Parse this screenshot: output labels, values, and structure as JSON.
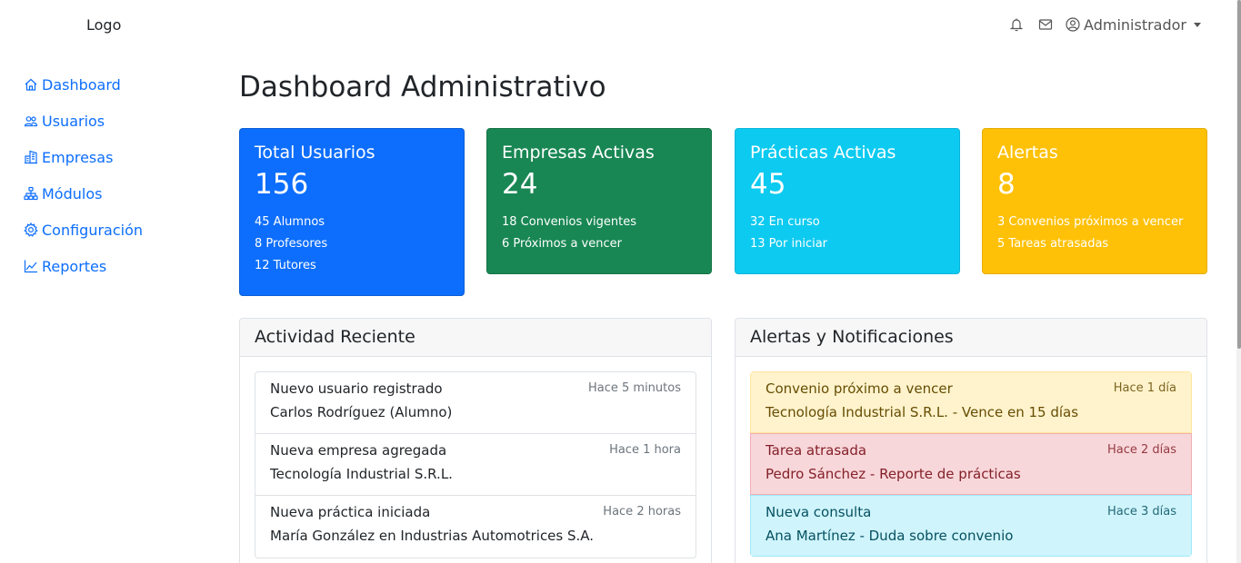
{
  "brand": {
    "logo": "Logo"
  },
  "sidebar": {
    "items": [
      {
        "label": "Dashboard",
        "icon": "house-icon"
      },
      {
        "label": "Usuarios",
        "icon": "people-icon"
      },
      {
        "label": "Empresas",
        "icon": "building-icon"
      },
      {
        "label": "Módulos",
        "icon": "diagram-icon"
      },
      {
        "label": "Configuración",
        "icon": "gear-icon"
      },
      {
        "label": "Reportes",
        "icon": "chart-line-icon"
      }
    ]
  },
  "topbar": {
    "user_label": "Administrador"
  },
  "page": {
    "title": "Dashboard Administrativo"
  },
  "stats": [
    {
      "title": "Total Usuarios",
      "value": "156",
      "lines": [
        "45 Alumnos",
        "8 Profesores",
        "12 Tutores"
      ],
      "color": "#0d6efd"
    },
    {
      "title": "Empresas Activas",
      "value": "24",
      "lines": [
        "18 Convenios vigentes",
        "6 Próximos a vencer"
      ],
      "color": "#198754"
    },
    {
      "title": "Prácticas Activas",
      "value": "45",
      "lines": [
        "32 En curso",
        "13 Por iniciar"
      ],
      "color": "#0dcaf0"
    },
    {
      "title": "Alertas",
      "value": "8",
      "lines": [
        "3 Convenios próximos a vencer",
        "5 Tareas atrasadas"
      ],
      "color": "#ffc107"
    }
  ],
  "activity": {
    "title": "Actividad Reciente",
    "items": [
      {
        "title": "Nuevo usuario registrado",
        "text": "Carlos Rodríguez (Alumno)",
        "time": "Hace 5 minutos"
      },
      {
        "title": "Nueva empresa agregada",
        "text": "Tecnología Industrial S.R.L.",
        "time": "Hace 1 hora"
      },
      {
        "title": "Nueva práctica iniciada",
        "text": "María González en Industrias Automotrices S.A.",
        "time": "Hace 2 horas"
      }
    ]
  },
  "alerts": {
    "title": "Alertas y Notificaciones",
    "items": [
      {
        "title": "Convenio próximo a vencer",
        "text": "Tecnología Industrial S.R.L. - Vence en 15 días",
        "time": "Hace 1 día",
        "type": "warning"
      },
      {
        "title": "Tarea atrasada",
        "text": "Pedro Sánchez - Reporte de prácticas",
        "time": "Hace 2 días",
        "type": "danger"
      },
      {
        "title": "Nueva consulta",
        "text": "Ana Martínez - Duda sobre convenio",
        "time": "Hace 3 días",
        "type": "info"
      }
    ]
  }
}
